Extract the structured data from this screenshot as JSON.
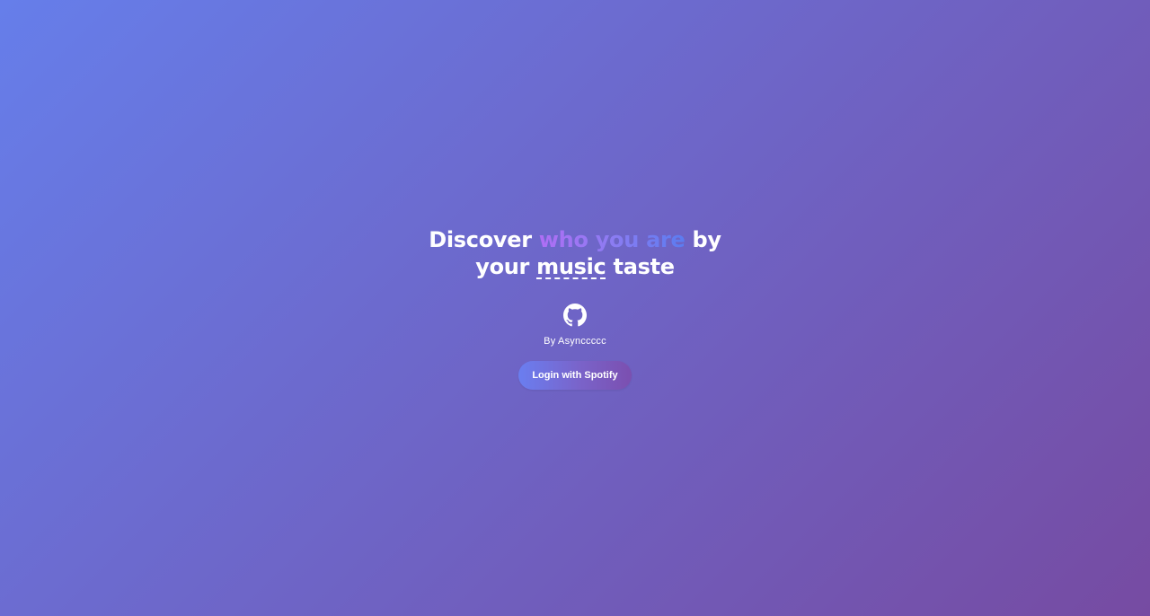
{
  "headline": {
    "part1": "Discover ",
    "highlight": "who you are",
    "part2": " by your ",
    "underlined": "music",
    "part3": " taste"
  },
  "github": {
    "icon": "github-icon"
  },
  "author": "By Asynccccc",
  "login_button": {
    "label": "Login with Spotify"
  },
  "colors": {
    "background_start": "#667eea",
    "background_end": "#764ba2",
    "highlight_start": "#b06ef5",
    "highlight_end": "#5b7cf0"
  }
}
